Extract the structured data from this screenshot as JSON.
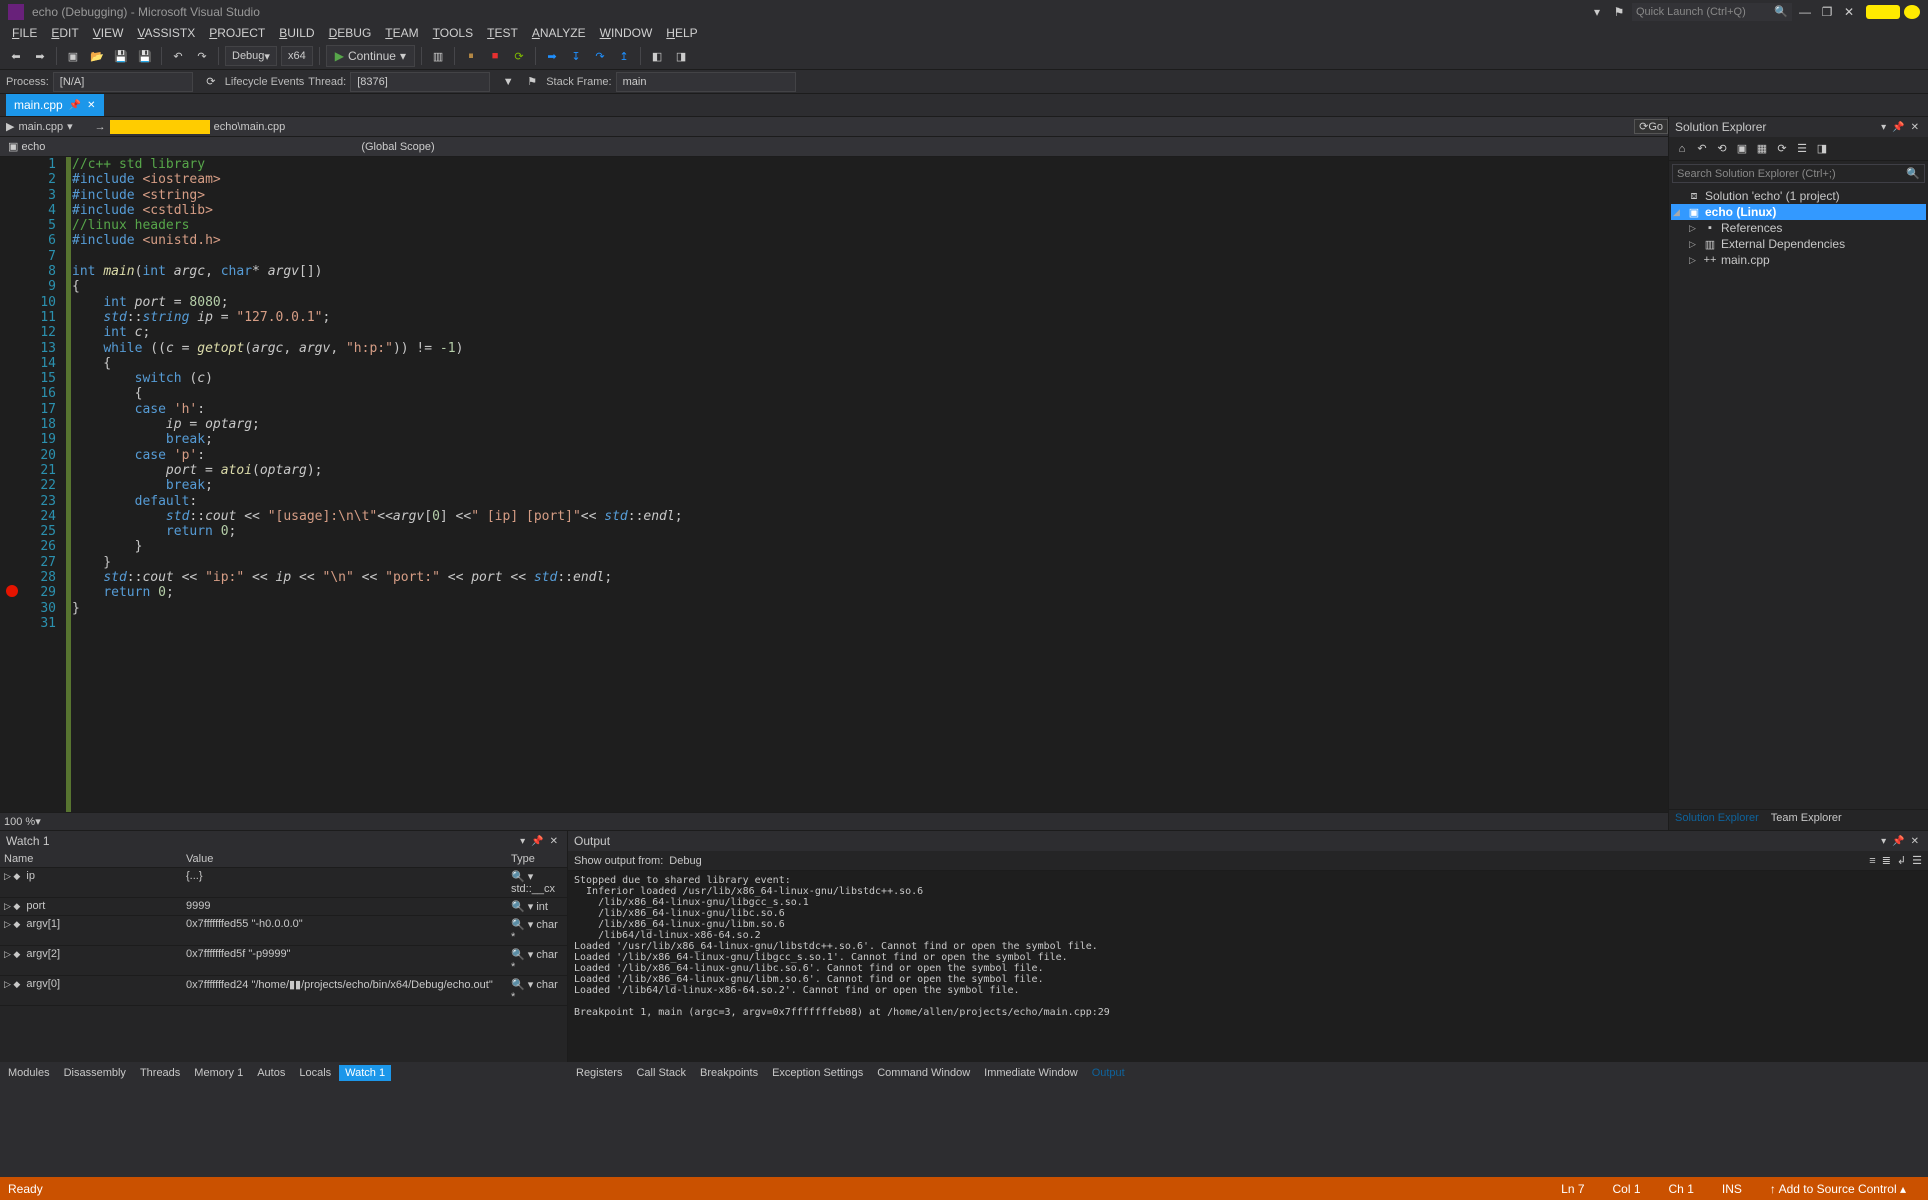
{
  "title": "echo (Debugging) - Microsoft Visual Studio",
  "quick_launch_placeholder": "Quick Launch (Ctrl+Q)",
  "menu": [
    "FILE",
    "EDIT",
    "VIEW",
    "VASSISTX",
    "PROJECT",
    "BUILD",
    "DEBUG",
    "TEAM",
    "TOOLS",
    "TEST",
    "ANALYZE",
    "WINDOW",
    "HELP"
  ],
  "toolbar": {
    "config": "Debug",
    "platform": "x64",
    "continue": "Continue"
  },
  "debug_row": {
    "process_label": "Process:",
    "process": "[N/A]",
    "lifecycle": "Lifecycle Events",
    "thread_label": "Thread:",
    "thread": "[8376]",
    "stack_label": "Stack Frame:",
    "stack": "main"
  },
  "tab": {
    "name": "main.cpp"
  },
  "editor_nav": {
    "file": "main.cpp",
    "path_tail": "echo\\main.cpp",
    "go": "Go"
  },
  "scope": {
    "left": "echo",
    "right": "(Global Scope)"
  },
  "code": [
    {
      "n": 1,
      "h": "<span class=c-com>//c++ std library</span>"
    },
    {
      "n": 2,
      "h": "<span class=c-kw>#include</span> <span class=c-str>&lt;iostream&gt;</span>"
    },
    {
      "n": 3,
      "h": "<span class=c-kw>#include</span> <span class=c-str>&lt;string&gt;</span>"
    },
    {
      "n": 4,
      "h": "<span class=c-kw>#include</span> <span class=c-str>&lt;cstdlib&gt;</span>"
    },
    {
      "n": 5,
      "h": "<span class=c-com>//linux headers</span>"
    },
    {
      "n": 6,
      "h": "<span class=c-kw>#include</span> <span class=c-str>&lt;unistd.h&gt;</span>"
    },
    {
      "n": 7,
      "h": ""
    },
    {
      "n": 8,
      "h": "<span class=c-kw>int</span> <span class=c-fn>main</span>(<span class=c-kw>int</span> <span class=c-id>argc</span>, <span class=c-kw>char</span>* <span class=c-id>argv</span>[])"
    },
    {
      "n": 9,
      "h": "{"
    },
    {
      "n": 10,
      "h": "    <span class=c-kw>int</span> <span class=c-id>port</span> = <span class=c-num>8080</span>;"
    },
    {
      "n": 11,
      "h": "    <span class=c-type>std</span>::<span class=c-type>string</span> <span class=c-id>ip</span> = <span class=c-str>\"127.0.0.1\"</span>;"
    },
    {
      "n": 12,
      "h": "    <span class=c-kw>int</span> <span class=c-id>c</span>;"
    },
    {
      "n": 13,
      "h": "    <span class=c-kw>while</span> ((<span class=c-id>c</span> = <span class=c-fn>getopt</span>(<span class=c-id>argc</span>, <span class=c-id>argv</span>, <span class=c-str>\"h:p:\"</span>)) != <span class=c-num>-1</span>)"
    },
    {
      "n": 14,
      "h": "    {"
    },
    {
      "n": 15,
      "h": "        <span class=c-kw>switch</span> (<span class=c-id>c</span>)"
    },
    {
      "n": 16,
      "h": "        {"
    },
    {
      "n": 17,
      "h": "        <span class=c-kw>case</span> <span class=c-str>'h'</span>:"
    },
    {
      "n": 18,
      "h": "            <span class=c-id>ip</span> = <span class=c-id>optarg</span>;"
    },
    {
      "n": 19,
      "h": "            <span class=c-kw>break</span>;"
    },
    {
      "n": 20,
      "h": "        <span class=c-kw>case</span> <span class=c-str>'p'</span>:"
    },
    {
      "n": 21,
      "h": "            <span class=c-id>port</span> = <span class=c-fn>atoi</span>(<span class=c-id>optarg</span>);"
    },
    {
      "n": 22,
      "h": "            <span class=c-kw>break</span>;"
    },
    {
      "n": 23,
      "h": "        <span class=c-kw>default</span>:"
    },
    {
      "n": 24,
      "h": "            <span class=c-type>std</span>::<span class=c-id>cout</span> &lt;&lt; <span class=c-str>\"[usage]:\\n\\t\"</span>&lt;&lt;<span class=c-id>argv</span>[<span class=c-num>0</span>] &lt;&lt;<span class=c-str>\" [ip] [port]\"</span>&lt;&lt; <span class=c-type>std</span>::<span class=c-id>endl</span>;"
    },
    {
      "n": 25,
      "h": "            <span class=c-kw>return</span> <span class=c-num>0</span>;"
    },
    {
      "n": 26,
      "h": "        }"
    },
    {
      "n": 27,
      "h": "    }"
    },
    {
      "n": 28,
      "h": "    <span class=c-type>std</span>::<span class=c-id>cout</span> &lt;&lt; <span class=c-str>\"ip:\"</span> &lt;&lt; <span class=c-id>ip</span> &lt;&lt; <span class=c-str>\"\\n\"</span> &lt;&lt; <span class=c-str>\"port:\"</span> &lt;&lt; <span class=c-id>port</span> &lt;&lt; <span class=c-type>std</span>::<span class=c-id>endl</span>;"
    },
    {
      "n": 29,
      "h": "    <span class=c-kw>return</span> <span class=c-num>0</span>;"
    },
    {
      "n": 30,
      "h": "}"
    },
    {
      "n": 31,
      "h": ""
    }
  ],
  "zoom": "100 %",
  "solution": {
    "title": "Solution Explorer",
    "search_placeholder": "Search Solution Explorer (Ctrl+;)",
    "sol": "Solution 'echo' (1 project)",
    "proj": "echo (Linux)",
    "refs": "References",
    "ext": "External Dependencies",
    "file": "main.cpp"
  },
  "watch": {
    "title": "Watch 1",
    "cols": [
      "Name",
      "Value",
      "Type"
    ],
    "rows": [
      {
        "name": "ip",
        "value": "{...}",
        "type": "std::__cx"
      },
      {
        "name": "port",
        "value": "9999",
        "type": "int"
      },
      {
        "name": "argv[1]",
        "value": "0x7fffffffed55 \"-h0.0.0.0\"",
        "type": "char *"
      },
      {
        "name": "argv[2]",
        "value": "0x7fffffffed5f \"-p9999\"",
        "type": "char *"
      },
      {
        "name": "argv[0]",
        "value": "0x7fffffffed24 \"/home/▮▮/projects/echo/bin/x64/Debug/echo.out\"",
        "type": "char *"
      }
    ]
  },
  "output": {
    "title": "Output",
    "from_label": "Show output from:",
    "source": "Debug",
    "body": "Stopped due to shared library event:\n  Inferior loaded /usr/lib/x86_64-linux-gnu/libstdc++.so.6\n    /lib/x86_64-linux-gnu/libgcc_s.so.1\n    /lib/x86_64-linux-gnu/libc.so.6\n    /lib/x86_64-linux-gnu/libm.so.6\n    /lib64/ld-linux-x86-64.so.2\nLoaded '/usr/lib/x86_64-linux-gnu/libstdc++.so.6'. Cannot find or open the symbol file.\nLoaded '/lib/x86_64-linux-gnu/libgcc_s.so.1'. Cannot find or open the symbol file.\nLoaded '/lib/x86_64-linux-gnu/libc.so.6'. Cannot find or open the symbol file.\nLoaded '/lib/x86_64-linux-gnu/libm.so.6'. Cannot find or open the symbol file.\nLoaded '/lib64/ld-linux-x86-64.so.2'. Cannot find or open the symbol file.\n\nBreakpoint 1, main (argc=3, argv=0x7fffffffeb08) at /home/allen/projects/echo/main.cpp:29"
  },
  "bottom_tabs_left": [
    "Modules",
    "Disassembly",
    "Threads",
    "Memory 1",
    "Autos",
    "Locals",
    "Watch 1"
  ],
  "bottom_tabs_right": [
    "Registers",
    "Call Stack",
    "Breakpoints",
    "Exception Settings",
    "Command Window",
    "Immediate Window",
    "Output"
  ],
  "se_tabs": [
    "Solution Explorer",
    "Team Explorer"
  ],
  "status": {
    "ready": "Ready",
    "ln": "Ln 7",
    "col": "Col 1",
    "ch": "Ch 1",
    "ins": "INS",
    "src": "Add to Source Control"
  }
}
